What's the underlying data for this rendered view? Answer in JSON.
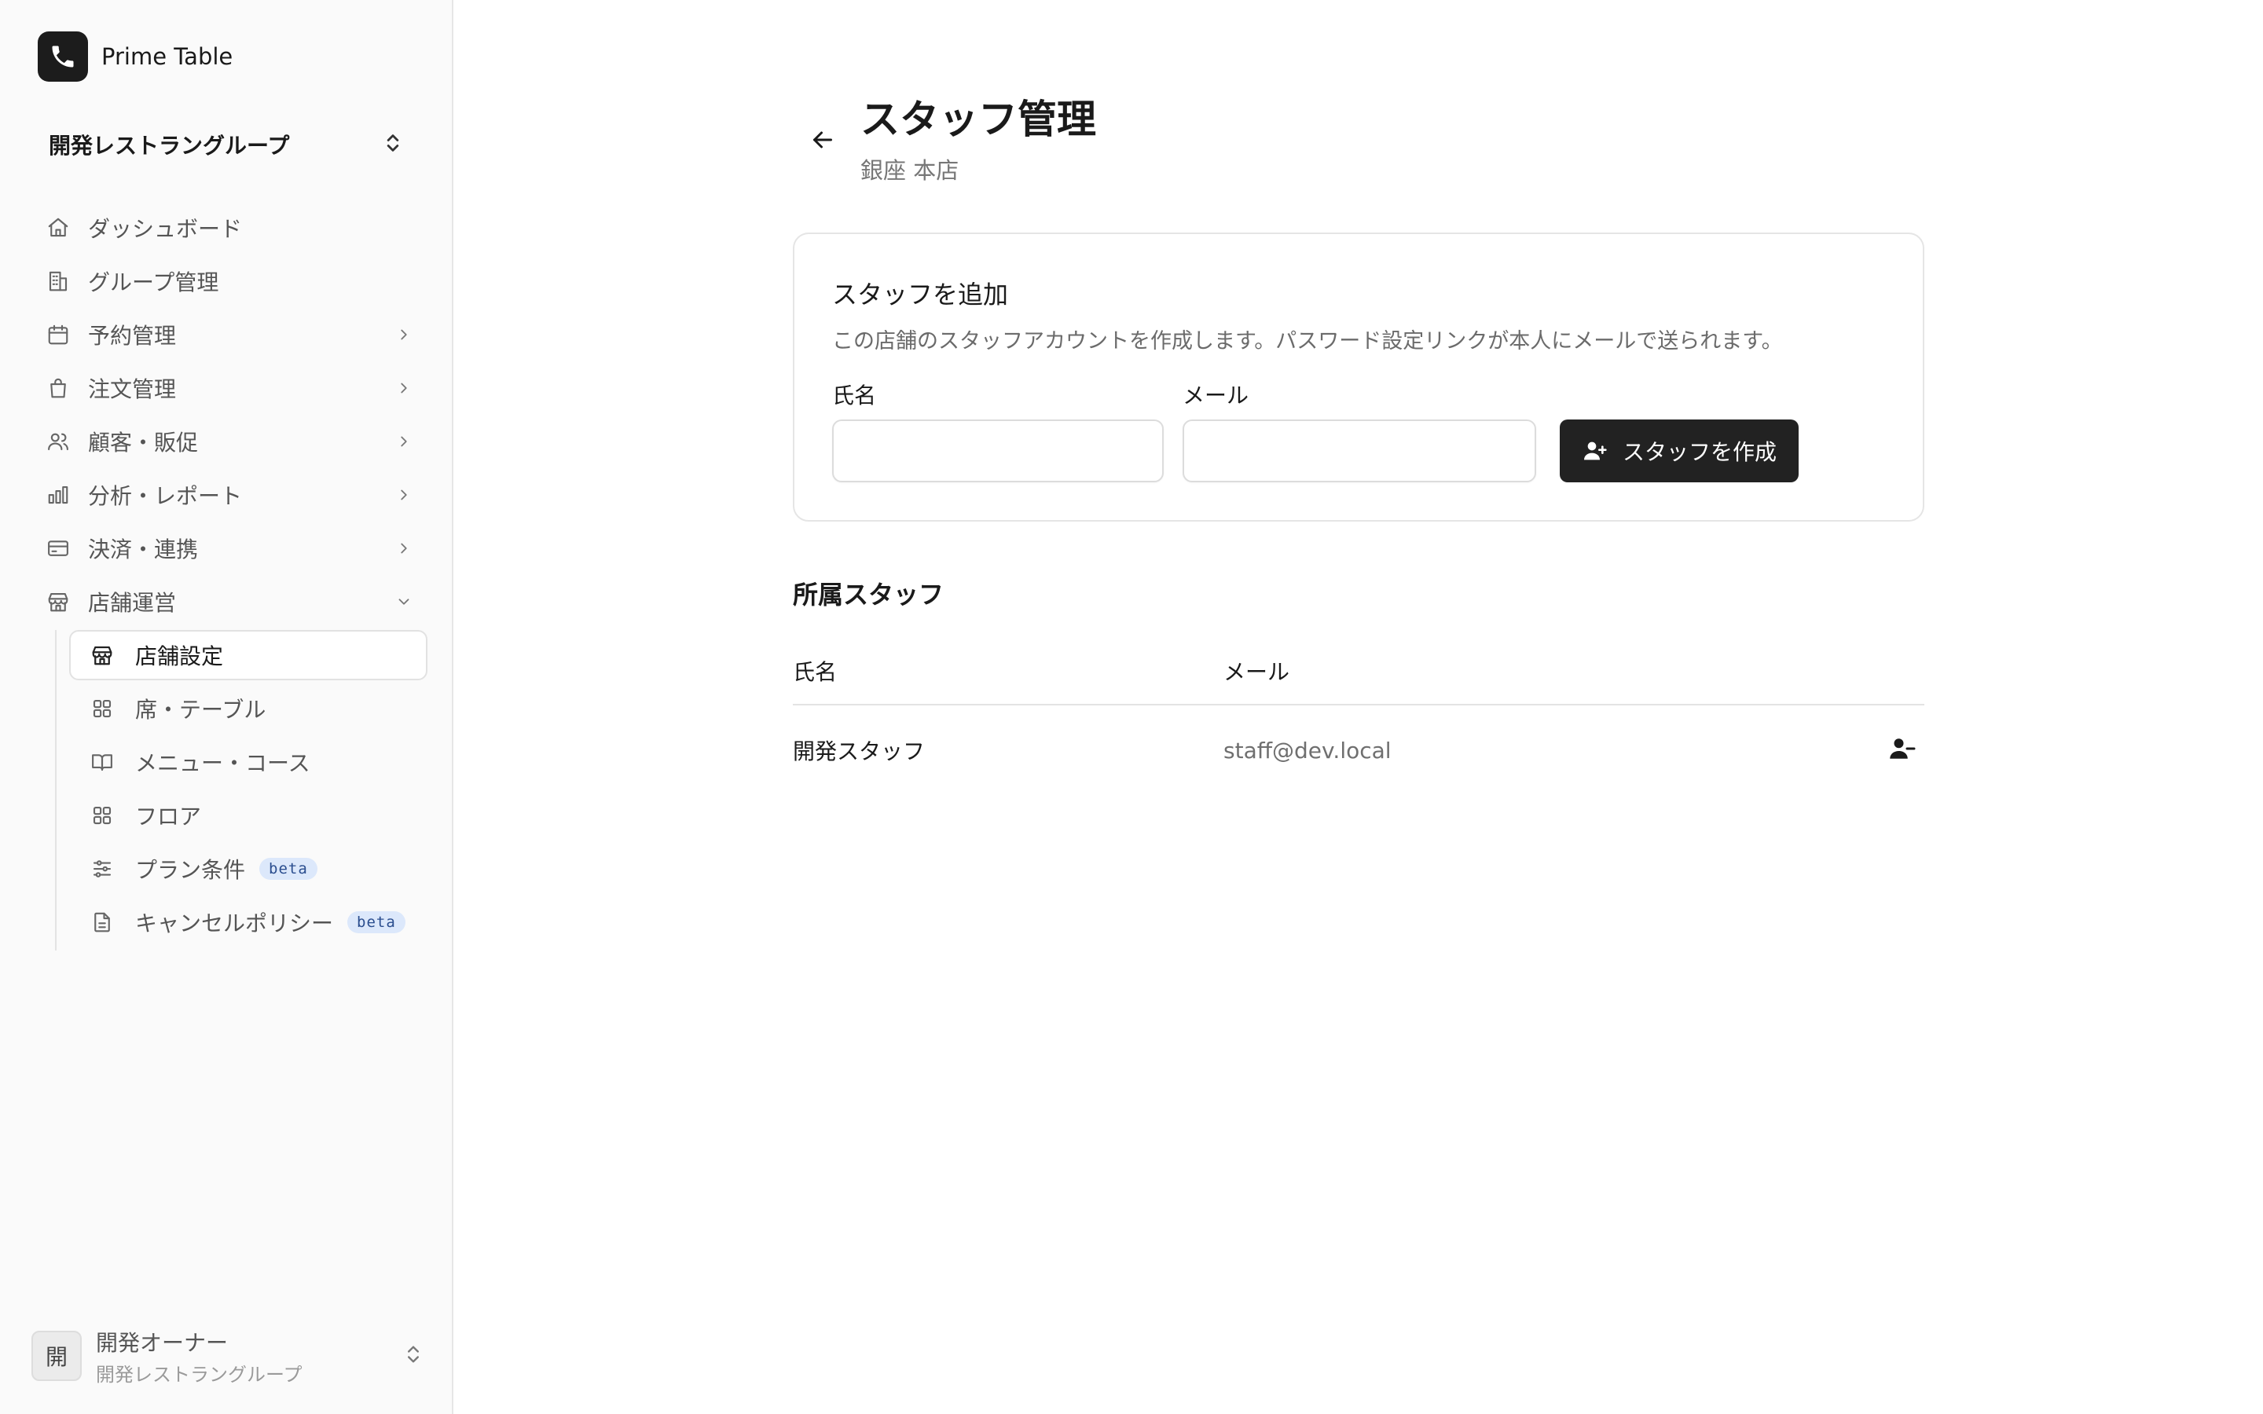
{
  "sidebar": {
    "brand": {
      "name": "Prime Table",
      "icon": "phone-icon"
    },
    "org_switcher": {
      "name": "開発レストラングループ",
      "icon": "chevrons-up-down-icon"
    },
    "nav_items": [
      {
        "label": "ダッシュボード",
        "icon": "home-icon"
      },
      {
        "label": "グループ管理",
        "icon": "building-icon"
      },
      {
        "label": "予約管理",
        "icon": "calendar-icon",
        "expandable": true
      },
      {
        "label": "注文管理",
        "icon": "shopping-bag-icon",
        "expandable": true
      },
      {
        "label": "顧客・販促",
        "icon": "users-icon",
        "expandable": true
      },
      {
        "label": "分析・レポート",
        "icon": "bar-chart-icon",
        "expandable": true
      },
      {
        "label": "決済・連携",
        "icon": "credit-card-icon",
        "expandable": true
      },
      {
        "label": "店舗運営",
        "icon": "store-icon",
        "expanded": true
      }
    ],
    "sub_items": [
      {
        "label": "店舗設定",
        "icon": "store-icon",
        "active": true
      },
      {
        "label": "席・テーブル",
        "icon": "grid-icon"
      },
      {
        "label": "メニュー・コース",
        "icon": "book-open-icon"
      },
      {
        "label": "フロア",
        "icon": "grid-icon"
      },
      {
        "label": "プラン条件",
        "icon": "sliders-icon",
        "badge": "beta"
      },
      {
        "label": "キャンセルポリシー",
        "icon": "file-text-icon",
        "badge": "beta"
      }
    ],
    "user": {
      "avatar_text": "開",
      "name": "開発オーナー",
      "org": "開発レストラングループ"
    }
  },
  "header": {
    "title": "スタッフ管理",
    "subtitle": "銀座 本店"
  },
  "add_staff": {
    "title": "スタッフを追加",
    "description": "この店舗のスタッフアカウントを作成します。パスワード設定リンクが本人にメールで送られます。",
    "name_label": "氏名",
    "name_value": "",
    "email_label": "メール",
    "email_value": "",
    "submit_label": "スタッフを作成"
  },
  "staff_list": {
    "title": "所属スタッフ",
    "columns": [
      "氏名",
      "メール"
    ],
    "rows": [
      {
        "name": "開発スタッフ",
        "email": "staff@dev.local"
      }
    ]
  },
  "colors": {
    "primary": "#222222",
    "sidebar_bg": "#fafafa",
    "beta_bg": "#dce8fb",
    "beta_text": "#2b4e8f"
  }
}
